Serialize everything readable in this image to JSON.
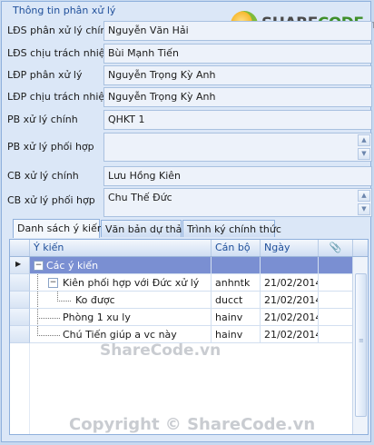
{
  "panel": {
    "title": "Thông tin phân xử lý"
  },
  "logo": {
    "brand_a": "SHARE",
    "brand_b": "CODE",
    "brand_c": ".vn"
  },
  "fields": [
    {
      "label": "LĐS phân xử lý chính",
      "value": "Nguyễn Văn Hải"
    },
    {
      "label": "LĐS chịu trách nhiệm",
      "value": "Bùi Mạnh Tiến"
    },
    {
      "label": "LĐP phân xử lý",
      "value": "Nguyễn Trọng Kỳ Anh"
    },
    {
      "label": "LĐP chịu trách nhiệm",
      "value": "Nguyễn Trọng Kỳ Anh"
    },
    {
      "label": "PB xử lý chính",
      "value": "QHKT 1"
    },
    {
      "label": "PB xử lý phối hợp",
      "value": ""
    },
    {
      "label": "CB xử lý chính",
      "value": "Lưu Hồng Kiên"
    },
    {
      "label": "CB xử lý phối hợp",
      "value": "Chu Thế Đức"
    }
  ],
  "tabs": [
    {
      "label": "Danh sách ý kiến",
      "active": true
    },
    {
      "label": "Văn bản dự thảo",
      "active": false
    },
    {
      "label": "Trình ký chính thức",
      "active": false
    }
  ],
  "grid": {
    "columns": [
      "Ý kiến",
      "Cán bộ",
      "Ngày",
      "📎"
    ],
    "rows": [
      {
        "opinion": "Các ý kiến",
        "officer": "",
        "date": "",
        "level": 0,
        "expandable": true,
        "selected": true
      },
      {
        "opinion": "Kiên phối hợp với Đức xử lý",
        "officer": "anhntk",
        "date": "21/02/2014",
        "level": 1,
        "expandable": true,
        "selected": false
      },
      {
        "opinion": "Ko được",
        "officer": "ducct",
        "date": "21/02/2014",
        "level": 2,
        "expandable": false,
        "selected": false
      },
      {
        "opinion": "Phòng 1 xu ly",
        "officer": "hainv",
        "date": "21/02/2014",
        "level": 1,
        "expandable": false,
        "selected": false
      },
      {
        "opinion": "Chú Tiến giúp a vc này",
        "officer": "hainv",
        "date": "21/02/2014",
        "level": 1,
        "expandable": false,
        "selected": false
      }
    ]
  },
  "watermarks": {
    "middle": "ShareCode.vn",
    "bottom": "Copyright © ShareCode.vn"
  },
  "colors": {
    "selection": "#7a8fd2",
    "panel_bg": "#dbe7f7",
    "border": "#8fb0dc",
    "title": "#1f4f9a"
  }
}
